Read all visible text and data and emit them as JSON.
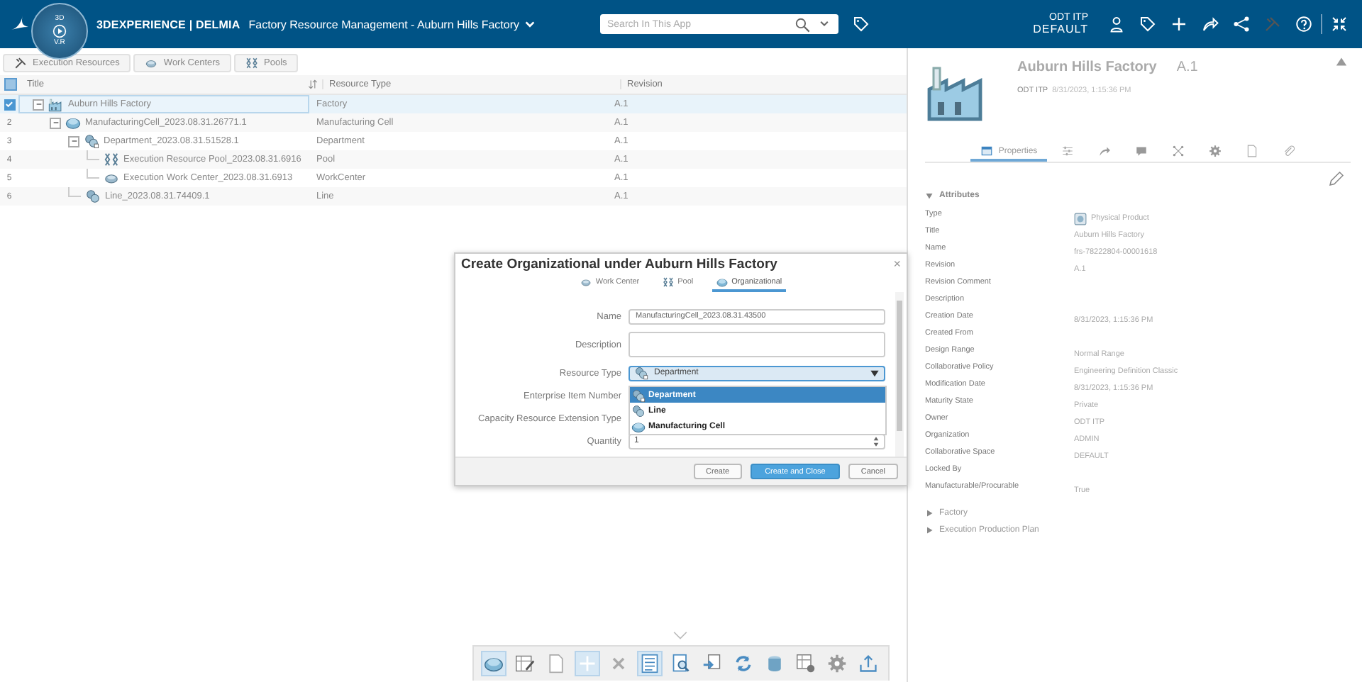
{
  "top_bar": {
    "compass": [
      "3D",
      "V.R"
    ],
    "brand": "3DEXPERIENCE | DELMIA",
    "app_title": "Factory Resource Management - Auburn Hills Factory",
    "search": {
      "placeholder": "Search In This App"
    },
    "user": "ODT ITP",
    "space": "DEFAULT",
    "actions": [
      {
        "kind": "user"
      },
      {
        "kind": "tag"
      },
      {
        "kind": "plus"
      },
      {
        "kind": "share"
      },
      {
        "kind": "network"
      },
      {
        "kind": "tools"
      },
      {
        "kind": "help"
      },
      {
        "kind": "collapse"
      }
    ]
  },
  "resource_tabs": [
    {
      "label": "Execution Resources",
      "kind": "tools"
    },
    {
      "label": "Work Centers",
      "kind": "workcenter"
    },
    {
      "label": "Pools",
      "kind": "pool"
    }
  ],
  "table": {
    "select_all_checked": true,
    "columns": [
      "Title",
      "Resource Type",
      "Revision"
    ],
    "rows": [
      {
        "selected": true,
        "expanded": true,
        "kind": "factory",
        "title": "Auburn Hills Factory",
        "type": "Factory",
        "revision": "A.1",
        "children": [
          {
            "number": "2",
            "selected": false,
            "expanded": true,
            "kind": "cell",
            "title": "ManufacturingCell_2023.08.31.26771.1",
            "type": "Manufacturing Cell",
            "revision": "A.1",
            "children": [
              {
                "number": "3",
                "selected": false,
                "expanded": true,
                "kind": "department",
                "title": "Department_2023.08.31.51528.1",
                "type": "Department",
                "revision": "A.1",
                "children": [
                  {
                    "number": "4",
                    "selected": false,
                    "kind": "pool",
                    "title": "Execution Resource Pool_2023.08.31.6916",
                    "type": "Pool",
                    "revision": "A.1"
                  },
                  {
                    "number": "5",
                    "selected": false,
                    "kind": "workcenter",
                    "title": "Execution Work Center_2023.08.31.6913",
                    "type": "WorkCenter",
                    "revision": "A.1"
                  }
                ]
              },
              {
                "number": "6",
                "selected": false,
                "kind": "line",
                "title": "Line_2023.08.31.74409.1",
                "type": "Line",
                "revision": "A.1"
              }
            ]
          }
        ]
      }
    ]
  },
  "dialog": {
    "title": "Create Organizational under Auburn Hills Factory",
    "close": "×",
    "tabs": [
      {
        "label": "Work Center",
        "kind": "workcenter",
        "selected": false
      },
      {
        "label": "Pool",
        "kind": "pool",
        "selected": false
      },
      {
        "label": "Organizational",
        "kind": "cell",
        "selected": true
      }
    ],
    "fields": [
      {
        "label": "Name",
        "kind": "text",
        "value": "ManufacturingCell_2023.08.31.43500"
      },
      {
        "label": "Description",
        "kind": "textarea"
      },
      {
        "label": "Resource Type",
        "kind": "select",
        "value": "Department"
      },
      {
        "label": "Enterprise Item Number",
        "kind": "covered"
      },
      {
        "label": "Capacity Resource Extension Type",
        "kind": "covered"
      },
      {
        "label": "Quantity",
        "kind": "number",
        "value": "1"
      }
    ],
    "dropdown": [
      {
        "label": "Department",
        "kind": "department",
        "selected": true
      },
      {
        "label": "Line",
        "kind": "line",
        "selected": false
      },
      {
        "label": "Manufacturing Cell",
        "kind": "cell",
        "selected": false
      }
    ],
    "buttons": [
      {
        "label": "Create",
        "kind": "secondary"
      },
      {
        "label": "Create and Close",
        "kind": "primary"
      },
      {
        "label": "Cancel",
        "kind": "secondary"
      }
    ]
  },
  "details": {
    "title": "Auburn Hills Factory",
    "revision": "A.1",
    "owner": "ODT ITP",
    "date": "8/31/2023, 1:15:36 PM",
    "tabs": [
      {
        "label": "Properties",
        "kind": "properties",
        "selected": true
      },
      {
        "kind": "sliders",
        "selected": false
      },
      {
        "kind": "arrow",
        "selected": false
      },
      {
        "kind": "comment",
        "selected": false
      },
      {
        "kind": "nodes",
        "selected": false
      },
      {
        "kind": "gear",
        "selected": false
      },
      {
        "kind": "document",
        "selected": false
      },
      {
        "kind": "clip",
        "selected": false
      }
    ],
    "sections": [
      {
        "label": "Attributes",
        "expanded": true,
        "attributes": [
          {
            "label": "Type",
            "value": "Physical Product",
            "kind": "typed"
          },
          {
            "label": "Title",
            "value": "Auburn Hills Factory"
          },
          {
            "label": "Name",
            "value": "frs-78222804-00001618"
          },
          {
            "label": "Revision",
            "value": "A.1"
          },
          {
            "label": "Revision Comment"
          },
          {
            "label": "Description"
          },
          {
            "label": "Creation Date",
            "value": "8/31/2023, 1:15:36 PM"
          },
          {
            "label": "Created From"
          },
          {
            "label": "Design Range",
            "value": "Normal Range"
          },
          {
            "label": "Collaborative Policy",
            "value": "Engineering Definition Classic"
          },
          {
            "label": "Modification Date",
            "value": "8/31/2023, 1:15:36 PM"
          },
          {
            "label": "Maturity State",
            "value": "Private"
          },
          {
            "label": "Owner",
            "value": "ODT ITP"
          },
          {
            "label": "Organization",
            "value": "ADMIN"
          },
          {
            "label": "Collaborative Space",
            "value": "DEFAULT"
          },
          {
            "label": "Locked By"
          },
          {
            "label": "Manufacturable/Procurable",
            "value": "True"
          }
        ]
      },
      {
        "label": "Factory",
        "expanded": false
      },
      {
        "label": "Execution Production Plan",
        "expanded": false
      }
    ]
  },
  "toolbar": [
    {
      "kind": "cell",
      "on": true
    },
    {
      "kind": "edit-table",
      "on": false
    },
    {
      "kind": "document",
      "on": false
    },
    {
      "kind": "plus",
      "on": true
    },
    {
      "kind": "delete",
      "on": false
    },
    {
      "kind": "list",
      "on": true
    },
    {
      "kind": "search-doc",
      "on": false
    },
    {
      "kind": "insert",
      "on": false
    },
    {
      "kind": "refresh",
      "on": false
    },
    {
      "kind": "cylinder",
      "on": false
    },
    {
      "kind": "table-gear",
      "on": false
    },
    {
      "kind": "gear",
      "on": false
    },
    {
      "kind": "upload",
      "on": false
    }
  ]
}
